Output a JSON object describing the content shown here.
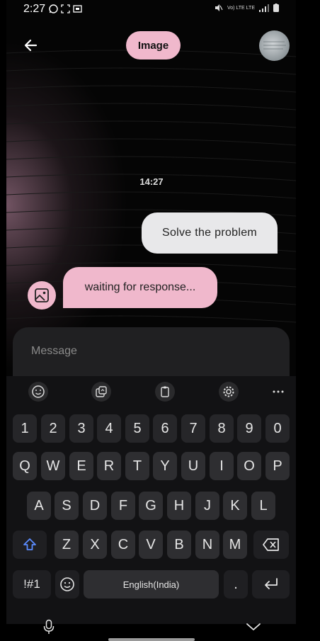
{
  "status_bar": {
    "time": "2:27",
    "network_label": "Vo) LTE LTE"
  },
  "header": {
    "title": "Image"
  },
  "chat": {
    "timestamp": "14:27",
    "user_message": "Solve  the problem",
    "bot_message": "waiting for response..."
  },
  "composer": {
    "placeholder": "Message"
  },
  "keyboard": {
    "number_row": [
      "1",
      "2",
      "3",
      "4",
      "5",
      "6",
      "7",
      "8",
      "9",
      "0"
    ],
    "row1": [
      "Q",
      "W",
      "E",
      "R",
      "T",
      "Y",
      "U",
      "I",
      "O",
      "P"
    ],
    "row2": [
      "A",
      "S",
      "D",
      "F",
      "G",
      "H",
      "J",
      "K",
      "L"
    ],
    "row3": [
      "Z",
      "X",
      "C",
      "V",
      "B",
      "N",
      "M"
    ],
    "symbols_label": "!#1",
    "space_label": "English(India)",
    "period_label": "."
  },
  "colors": {
    "accent_pink": "#f0b8cc",
    "shift_blue": "#5b8cff"
  }
}
